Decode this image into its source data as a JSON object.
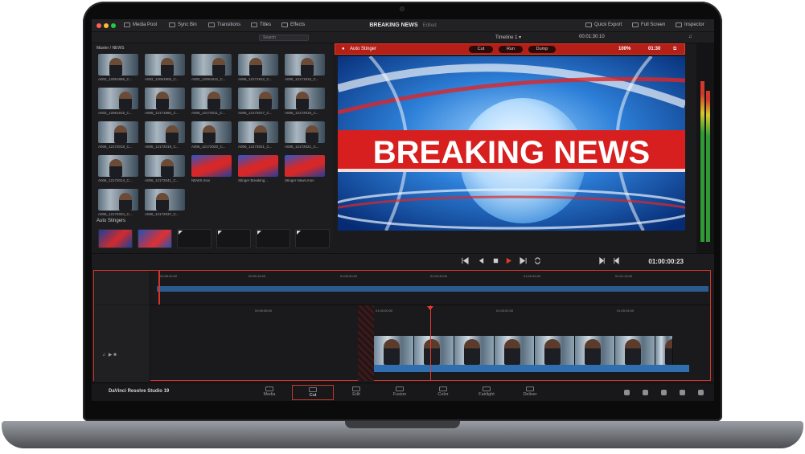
{
  "app": {
    "title": "BREAKING NEWS",
    "edited": "Edited",
    "brand": "DaVinci Resolve Studio 19"
  },
  "topbar": {
    "media_pool": "Media Pool",
    "sync_bin": "Sync Bin",
    "transitions": "Transitions",
    "titles": "Titles",
    "effects": "Effects",
    "quick_export": "Quick Export",
    "full_screen": "Full Screen",
    "inspector": "Inspector"
  },
  "toolbar": {
    "search_placeholder": "Search",
    "timeline_name": "Timeline 1",
    "source_tc": "00:01:30:10"
  },
  "pool": {
    "path": "Master / NEWS",
    "clips": [
      "A002_12061856_C...",
      "A002_12061905_C...",
      "A002_12061912_C...",
      "A006_12171912_C...",
      "A006_12171915_C...",
      "A002_12061915_C...",
      "A006_12171950_C...",
      "A006_12172011_C...",
      "A006_12172017_C...",
      "A006_12172019_C...",
      "A006_12172018_C...",
      "A006_12172019_C...",
      "A006_12172020_C...",
      "A006_12172021_C...",
      "A006_12172021_C...",
      "A006_12172014_C...",
      "A006_12172041_C...",
      "NEWS.mov",
      "Stinger Breaking...",
      "Stinger News.mov",
      "A006_12172034_C...",
      "A006_12172037_C..."
    ],
    "auto_stingers_label": "Auto Stingers"
  },
  "viewer": {
    "auto_stinger": "Auto Stinger",
    "cut": "Cut",
    "run": "Run",
    "dump": "Dump",
    "zoom": "100%",
    "duration": "01:30",
    "headline": "BREAKING NEWS"
  },
  "transport": {
    "timecode": "01:00:00:23"
  },
  "timeline": {
    "upper_ruler": [
      "00:58:40:00",
      "00:59:16:00",
      "01:00:00:00",
      "01:00:30:00",
      "01:00:45:00",
      "01:01:15:00"
    ],
    "lower_ruler": [
      "00:59:58:00",
      "01:00:00:00",
      "01:00:02:00",
      "01:00:04:00"
    ]
  },
  "pages": [
    "Media",
    "Cut",
    "Edit",
    "Fusion",
    "Color",
    "Fairlight",
    "Deliver"
  ],
  "active_page": "Cut",
  "colors": {
    "accent_red": "#c0392b",
    "clip_blue": "#2f6fb0",
    "meter_green": "#3aa13a"
  }
}
